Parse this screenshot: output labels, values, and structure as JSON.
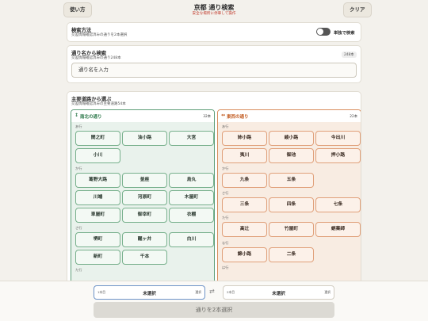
{
  "header": {
    "help_label": "使い方",
    "title": "京都 通り検索",
    "subtitle": "安全な場所に停車して操作",
    "clear_label": "クリア"
  },
  "search_method": {
    "title": "検索方法",
    "subtitle": "交差情報確認済みの通りを2本選択",
    "toggle_label": "単独で検索",
    "toggle_on": false
  },
  "name_search": {
    "title": "通り名から検索",
    "subtitle": "交差情報確認済みの通り248本",
    "count_badge": "248本",
    "placeholder": "通り名を入力"
  },
  "main_roads": {
    "title": "主要道路から選ぶ",
    "subtitle": "交差情報確認済みの主要道路54本",
    "north_south": {
      "arrow": "↕",
      "label": "南北の通り",
      "count": "32本",
      "groups": [
        {
          "label": "あ行",
          "items": [
            "間之町",
            "油小路",
            "大宮",
            "小川"
          ]
        },
        {
          "label": "か行",
          "items": [
            "葛野大路",
            "釜座",
            "烏丸",
            "川端",
            "河原町",
            "木屋町",
            "車屋町",
            "御幸町",
            "衣棚"
          ]
        },
        {
          "label": "さ行",
          "items": [
            "堺町",
            "醒ヶ井",
            "白川",
            "新町",
            "千本"
          ]
        },
        {
          "label": "た行",
          "items": []
        }
      ]
    },
    "east_west": {
      "arrow": "↔",
      "label": "東西の通り",
      "count": "22本",
      "groups": [
        {
          "label": "あ行",
          "items": [
            "姉小路",
            "綾小路",
            "今出川",
            "夷川",
            "御池",
            "押小路"
          ]
        },
        {
          "label": "か行",
          "items": [
            "九条",
            "五条"
          ]
        },
        {
          "label": "さ行",
          "items": [
            "三条",
            "四条",
            "七条"
          ]
        },
        {
          "label": "た行",
          "items": [
            "高辻",
            "竹屋町",
            "蛸薬師"
          ]
        },
        {
          "label": "な行",
          "items": [
            "錦小路",
            "二条"
          ]
        },
        {
          "label": "は行",
          "items": []
        }
      ]
    }
  },
  "selection": {
    "slot1_label": "1本目",
    "slot1_value": "未選択",
    "slot2_label": "2本目",
    "slot2_value": "未選択",
    "select_label": "選択",
    "swap_icon": "⇄",
    "submit_label": "通りを2本選択"
  }
}
